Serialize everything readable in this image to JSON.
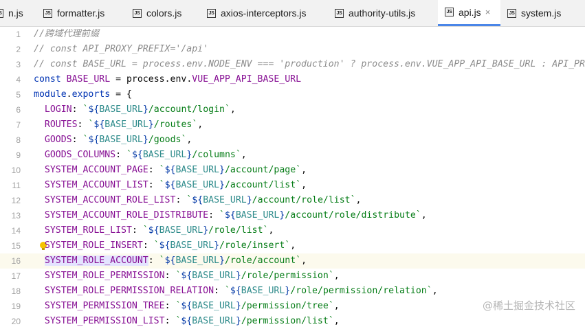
{
  "tabs": [
    {
      "label": "n.js",
      "icon": "js-file-icon",
      "active": false
    },
    {
      "label": "formatter.js",
      "icon": "js-file-icon",
      "active": false
    },
    {
      "label": "colors.js",
      "icon": "js-file-icon",
      "active": false
    },
    {
      "label": "axios-interceptors.js",
      "icon": "js-file-icon",
      "active": false
    },
    {
      "label": "authority-utils.js",
      "icon": "js-file-icon",
      "active": false
    },
    {
      "label": "api.js",
      "icon": "js-file-icon",
      "active": true,
      "close": "×"
    },
    {
      "label": "system.js",
      "icon": "js-file-icon",
      "active": false
    }
  ],
  "js_icon_text": "JS",
  "current_line": 16,
  "lines": [
    {
      "n": "1",
      "segs": [
        [
          "comment",
          "//跨域代理前缀"
        ]
      ]
    },
    {
      "n": "2",
      "segs": [
        [
          "comment",
          "// const API_PROXY_PREFIX='/api'"
        ]
      ]
    },
    {
      "n": "3",
      "segs": [
        [
          "comment",
          "// const BASE_URL = process.env.NODE_ENV === 'production' ? process.env.VUE_APP_API_BASE_URL : API_PR"
        ]
      ]
    },
    {
      "n": "4",
      "segs": [
        [
          "keyword",
          "const "
        ],
        [
          "var",
          "BASE_URL"
        ],
        [
          "punct",
          " = process.env."
        ],
        [
          "const",
          "VUE_APP_API_BASE_URL"
        ]
      ]
    },
    {
      "n": "5",
      "segs": [
        [
          "keyword",
          "module"
        ],
        [
          "punct",
          "."
        ],
        [
          "keyword",
          "exports"
        ],
        [
          "punct",
          " = {"
        ]
      ]
    },
    {
      "n": "6",
      "segs": [
        [
          "punct",
          "  "
        ],
        [
          "const",
          "LOGIN"
        ],
        [
          "punct",
          ": "
        ],
        [
          "string",
          "`"
        ],
        [
          "interp",
          "${"
        ],
        [
          "template-var",
          "BASE_URL"
        ],
        [
          "interp",
          "}"
        ],
        [
          "string",
          "/account/login`"
        ],
        [
          "punct",
          ","
        ]
      ]
    },
    {
      "n": "7",
      "segs": [
        [
          "punct",
          "  "
        ],
        [
          "const",
          "ROUTES"
        ],
        [
          "punct",
          ": "
        ],
        [
          "string",
          "`"
        ],
        [
          "interp",
          "${"
        ],
        [
          "template-var",
          "BASE_URL"
        ],
        [
          "interp",
          "}"
        ],
        [
          "string",
          "/routes`"
        ],
        [
          "punct",
          ","
        ]
      ]
    },
    {
      "n": "8",
      "segs": [
        [
          "punct",
          "  "
        ],
        [
          "const",
          "GOODS"
        ],
        [
          "punct",
          ": "
        ],
        [
          "string",
          "`"
        ],
        [
          "interp",
          "${"
        ],
        [
          "template-var",
          "BASE_URL"
        ],
        [
          "interp",
          "}"
        ],
        [
          "string",
          "/goods`"
        ],
        [
          "punct",
          ","
        ]
      ]
    },
    {
      "n": "9",
      "segs": [
        [
          "punct",
          "  "
        ],
        [
          "const",
          "GOODS_COLUMNS"
        ],
        [
          "punct",
          ": "
        ],
        [
          "string",
          "`"
        ],
        [
          "interp",
          "${"
        ],
        [
          "template-var",
          "BASE_URL"
        ],
        [
          "interp",
          "}"
        ],
        [
          "string",
          "/columns`"
        ],
        [
          "punct",
          ","
        ]
      ]
    },
    {
      "n": "10",
      "segs": [
        [
          "punct",
          "  "
        ],
        [
          "const",
          "SYSTEM_ACCOUNT_PAGE"
        ],
        [
          "punct",
          ": "
        ],
        [
          "string",
          "`"
        ],
        [
          "interp",
          "${"
        ],
        [
          "template-var",
          "BASE_URL"
        ],
        [
          "interp",
          "}"
        ],
        [
          "string",
          "/account/page`"
        ],
        [
          "punct",
          ","
        ]
      ]
    },
    {
      "n": "11",
      "segs": [
        [
          "punct",
          "  "
        ],
        [
          "const",
          "SYSTEM_ACCOUNT_LIST"
        ],
        [
          "punct",
          ": "
        ],
        [
          "string",
          "`"
        ],
        [
          "interp",
          "${"
        ],
        [
          "template-var",
          "BASE_URL"
        ],
        [
          "interp",
          "}"
        ],
        [
          "string",
          "/account/list`"
        ],
        [
          "punct",
          ","
        ]
      ]
    },
    {
      "n": "12",
      "segs": [
        [
          "punct",
          "  "
        ],
        [
          "const",
          "SYSTEM_ACCOUNT_ROLE_LIST"
        ],
        [
          "punct",
          ": "
        ],
        [
          "string",
          "`"
        ],
        [
          "interp",
          "${"
        ],
        [
          "template-var",
          "BASE_URL"
        ],
        [
          "interp",
          "}"
        ],
        [
          "string",
          "/account/role/list`"
        ],
        [
          "punct",
          ","
        ]
      ]
    },
    {
      "n": "13",
      "segs": [
        [
          "punct",
          "  "
        ],
        [
          "const",
          "SYSTEM_ACCOUNT_ROLE_DISTRIBUTE"
        ],
        [
          "punct",
          ": "
        ],
        [
          "string",
          "`"
        ],
        [
          "interp",
          "${"
        ],
        [
          "template-var",
          "BASE_URL"
        ],
        [
          "interp",
          "}"
        ],
        [
          "string",
          "/account/role/distribute`"
        ],
        [
          "punct",
          ","
        ]
      ]
    },
    {
      "n": "14",
      "segs": [
        [
          "punct",
          "  "
        ],
        [
          "const",
          "SYSTEM_ROLE_LIST"
        ],
        [
          "punct",
          ": "
        ],
        [
          "string",
          "`"
        ],
        [
          "interp",
          "${"
        ],
        [
          "template-var",
          "BASE_URL"
        ],
        [
          "interp",
          "}"
        ],
        [
          "string",
          "/role/list`"
        ],
        [
          "punct",
          ","
        ]
      ]
    },
    {
      "n": "15",
      "bulb": true,
      "segs": [
        [
          "punct",
          "  "
        ],
        [
          "const",
          "SYSTEM_ROLE_INSERT"
        ],
        [
          "punct",
          ": "
        ],
        [
          "string",
          "`"
        ],
        [
          "interp",
          "${"
        ],
        [
          "template-var",
          "BASE_URL"
        ],
        [
          "interp",
          "}"
        ],
        [
          "string",
          "/role/insert`"
        ],
        [
          "punct",
          ","
        ]
      ]
    },
    {
      "n": "16",
      "segs": [
        [
          "punct",
          "  "
        ],
        [
          "highlight",
          "SYSTEM_ROLE_ACCOUNT"
        ],
        [
          "punct",
          ": "
        ],
        [
          "string",
          "`"
        ],
        [
          "interp",
          "${"
        ],
        [
          "template-var",
          "BASE_URL"
        ],
        [
          "interp",
          "}"
        ],
        [
          "string",
          "/role/account`"
        ],
        [
          "punct",
          ","
        ]
      ]
    },
    {
      "n": "17",
      "segs": [
        [
          "punct",
          "  "
        ],
        [
          "const",
          "SYSTEM_ROLE_PERMISSION"
        ],
        [
          "punct",
          ": "
        ],
        [
          "string",
          "`"
        ],
        [
          "interp",
          "${"
        ],
        [
          "template-var",
          "BASE_URL"
        ],
        [
          "interp",
          "}"
        ],
        [
          "string",
          "/role/permission`"
        ],
        [
          "punct",
          ","
        ]
      ]
    },
    {
      "n": "18",
      "segs": [
        [
          "punct",
          "  "
        ],
        [
          "const",
          "SYSTEM_ROLE_PERMISSION_RELATION"
        ],
        [
          "punct",
          ": "
        ],
        [
          "string",
          "`"
        ],
        [
          "interp",
          "${"
        ],
        [
          "template-var",
          "BASE_URL"
        ],
        [
          "interp",
          "}"
        ],
        [
          "string",
          "/role/permission/relation`"
        ],
        [
          "punct",
          ","
        ]
      ]
    },
    {
      "n": "19",
      "segs": [
        [
          "punct",
          "  "
        ],
        [
          "const",
          "SYSTEM_PERMISSION_TREE"
        ],
        [
          "punct",
          ": "
        ],
        [
          "string",
          "`"
        ],
        [
          "interp",
          "${"
        ],
        [
          "template-var",
          "BASE_URL"
        ],
        [
          "interp",
          "}"
        ],
        [
          "string",
          "/permission/tree`"
        ],
        [
          "punct",
          ","
        ]
      ]
    },
    {
      "n": "20",
      "segs": [
        [
          "punct",
          "  "
        ],
        [
          "const",
          "SYSTEM_PERMISSION_LIST"
        ],
        [
          "punct",
          ": "
        ],
        [
          "string",
          "`"
        ],
        [
          "interp",
          "${"
        ],
        [
          "template-var",
          "BASE_URL"
        ],
        [
          "interp",
          "}"
        ],
        [
          "string",
          "/permission/list`"
        ],
        [
          "punct",
          ","
        ]
      ]
    }
  ],
  "watermark": "@稀土掘金技术社区"
}
